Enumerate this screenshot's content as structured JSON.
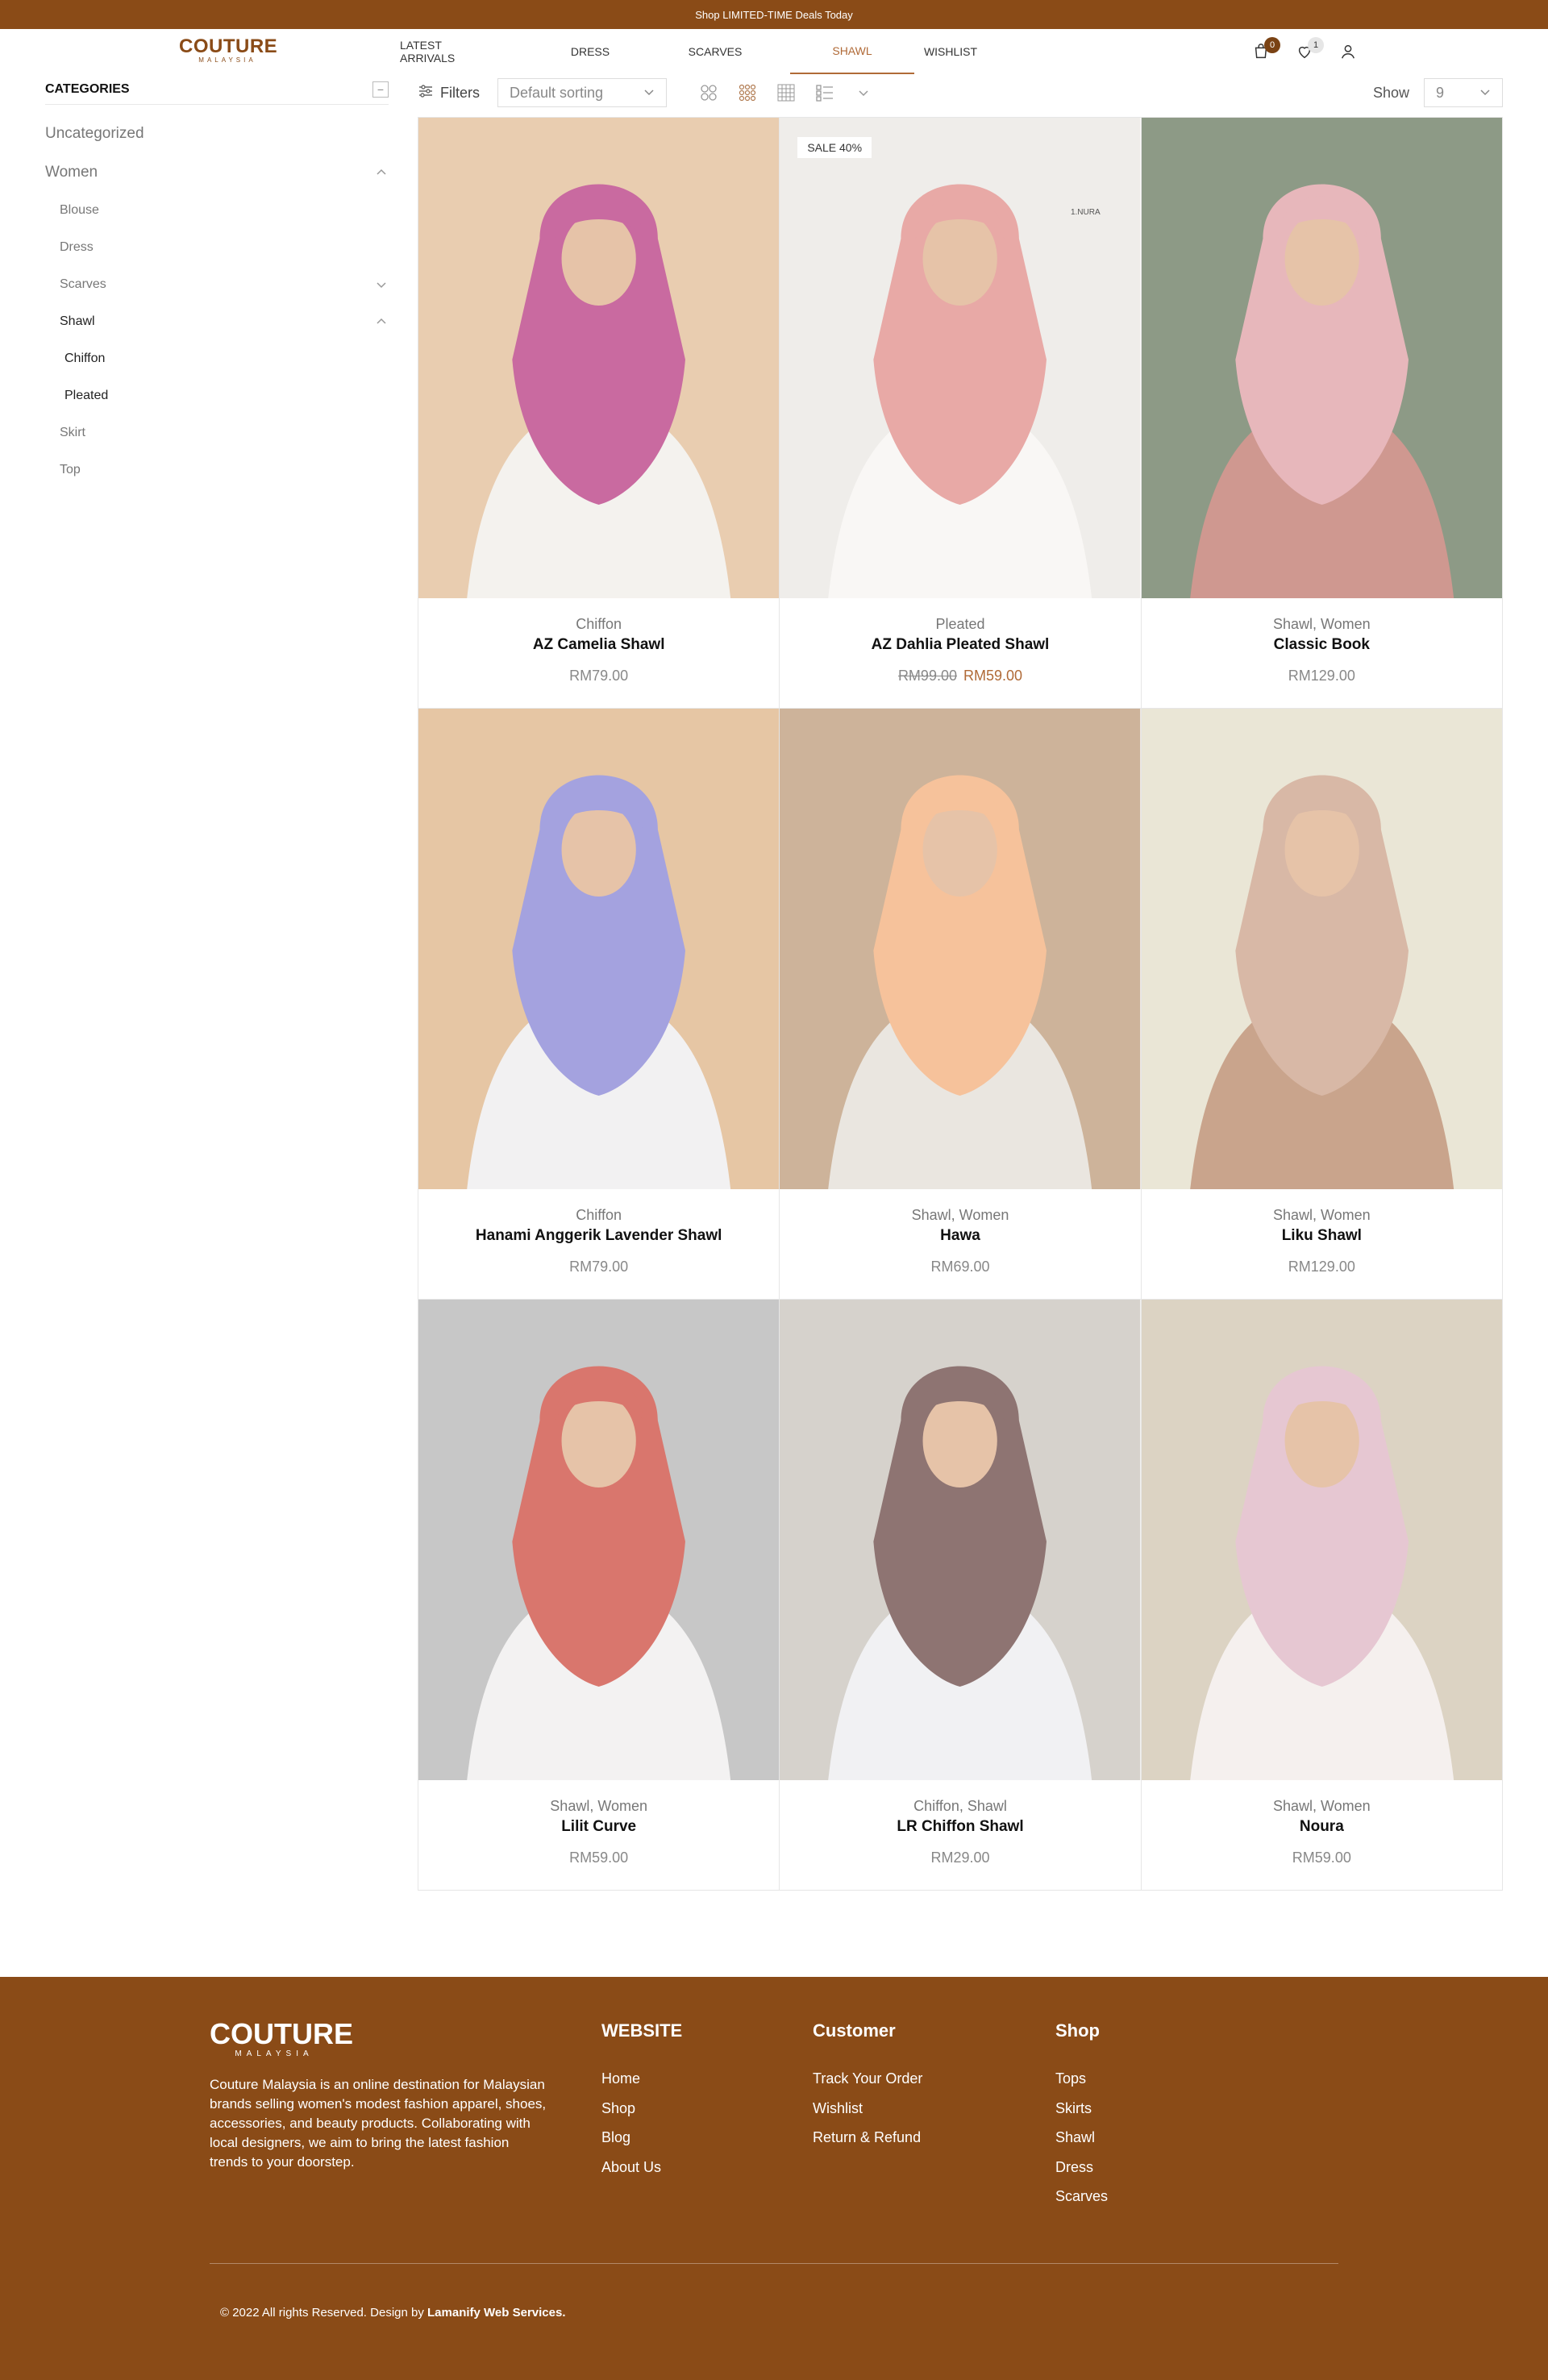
{
  "topbar": {
    "text": "Shop LIMITED-TIME Deals Today"
  },
  "header": {
    "logo_main": "COUTURE",
    "logo_sub": "MALAYSIA",
    "nav": [
      "LATEST ARRIVALS",
      "DRESS",
      "SCARVES",
      "SHAWL",
      "WISHLIST"
    ],
    "active_nav": "SHAWL",
    "cart_count": "0",
    "wishlist_count": "1",
    "icons": [
      "cart-icon",
      "heart-icon",
      "user-icon"
    ]
  },
  "sidebar": {
    "title": "CATEGORIES",
    "collapse_symbol": "−",
    "items": [
      {
        "label": "Uncategorized",
        "level": 0
      },
      {
        "label": "Women",
        "level": 0,
        "expanded": true
      },
      {
        "label": "Blouse",
        "level": 1
      },
      {
        "label": "Dress",
        "level": 1
      },
      {
        "label": "Scarves",
        "level": 1,
        "expanded": false
      },
      {
        "label": "Shawl",
        "level": 1,
        "expanded": true
      },
      {
        "label": "Chiffon",
        "level": 2
      },
      {
        "label": "Pleated",
        "level": 2
      },
      {
        "label": "Skirt",
        "level": 1
      },
      {
        "label": "Top",
        "level": 1
      }
    ]
  },
  "toolbar": {
    "filters_label": "Filters",
    "sort_value": "Default sorting",
    "show_label": "Show",
    "show_value": "9",
    "view_icons": [
      "grid-2-icon",
      "grid-3-icon",
      "grid-4-icon",
      "list-icon"
    ]
  },
  "products": [
    {
      "category": "Chiffon",
      "name": "AZ Camelia Shawl",
      "price": "RM79.00",
      "old_price": "",
      "sale_badge": "",
      "tag": "",
      "colors": [
        "#e9cdb0",
        "#c96aa0",
        "#f4f2ee"
      ]
    },
    {
      "category": "Pleated",
      "name": "AZ Dahlia Pleated Shawl",
      "price": "RM59.00",
      "old_price": "RM99.00",
      "sale_badge": "SALE 40%",
      "tag": "1.NURA",
      "colors": [
        "#efedea",
        "#e8a9a6",
        "#f9f7f5"
      ]
    },
    {
      "category": "Shawl, Women",
      "name": "Classic Book",
      "price": "RM129.00",
      "old_price": "",
      "sale_badge": "",
      "tag": "",
      "colors": [
        "#8d9a86",
        "#e7b7bb",
        "#cf9890"
      ]
    },
    {
      "category": "Chiffon",
      "name": "Hanami Anggerik Lavender Shawl",
      "price": "RM79.00",
      "old_price": "",
      "sale_badge": "",
      "tag": "",
      "colors": [
        "#e6c6a4",
        "#a4a2df",
        "#f2f1f2"
      ]
    },
    {
      "category": "Shawl, Women",
      "name": "Hawa",
      "price": "RM69.00",
      "old_price": "",
      "sale_badge": "",
      "tag": "",
      "colors": [
        "#cdb39a",
        "#f6c29b",
        "#eae6e0"
      ]
    },
    {
      "category": "Shawl, Women",
      "name": "Liku Shawl",
      "price": "RM129.00",
      "old_price": "",
      "sale_badge": "",
      "tag": "",
      "colors": [
        "#eae6d6",
        "#d8b8a6",
        "#c9a48c"
      ]
    },
    {
      "category": "Shawl, Women",
      "name": "Lilit Curve",
      "price": "RM59.00",
      "old_price": "",
      "sale_badge": "",
      "tag": "",
      "colors": [
        "#c7c7c7",
        "#d9766d",
        "#f3f2f2"
      ]
    },
    {
      "category": "Chiffon, Shawl",
      "name": "LR Chiffon Shawl",
      "price": "RM29.00",
      "old_price": "",
      "sale_badge": "",
      "tag": "",
      "colors": [
        "#d6d2cc",
        "#8e7472",
        "#f1f1f3"
      ]
    },
    {
      "category": "Shawl, Women",
      "name": "Noura",
      "price": "RM59.00",
      "old_price": "",
      "sale_badge": "",
      "tag": "",
      "colors": [
        "#dcd3c3",
        "#e6c7d2",
        "#f5f0ee"
      ]
    }
  ],
  "footer": {
    "logo_main": "COUTURE",
    "logo_sub": "MALAYSIA",
    "about": "Couture Malaysia is an online destination for Malaysian brands selling women's modest fashion apparel, shoes, accessories, and beauty products. Collaborating with local designers, we aim to bring the latest fashion trends to your doorstep.",
    "columns": [
      {
        "title": "WEBSITE",
        "links": [
          "Home",
          "Shop",
          "Blog",
          "About Us"
        ]
      },
      {
        "title": "Customer",
        "links": [
          "Track Your Order",
          "Wishlist",
          "Return & Refund"
        ]
      },
      {
        "title": "Shop",
        "links": [
          "Tops",
          "Skirts",
          "Shawl",
          "Dress",
          "Scarves"
        ]
      }
    ],
    "copyright_prefix": "© 2022 All rights Reserved. Design by ",
    "copyright_brand": "Lamanify Web Services."
  }
}
